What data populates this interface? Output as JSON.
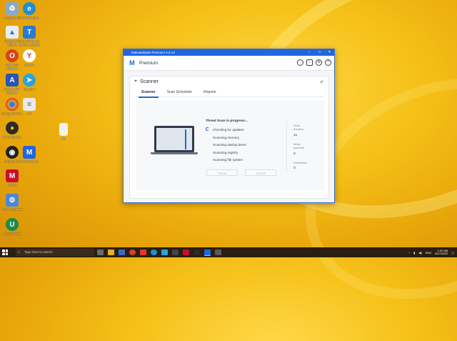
{
  "desktop": {
    "icons": [
      {
        "label": "Recycle Bin",
        "icon": "recycle-bin-icon",
        "color": "#8aa9c8"
      },
      {
        "label": "Microsoft Edge",
        "icon": "edge-icon",
        "color": "#1e8fd6"
      },
      {
        "label": "Google File Stream",
        "icon": "drive-icon",
        "color": "#e8eef7"
      },
      {
        "label": "Microsoft Teams (work or school)",
        "icon": "teams-icon",
        "color": "#2b79d8"
      },
      {
        "label": "Opera GX Browser",
        "icon": "opera-icon",
        "color": "#d4451a"
      },
      {
        "label": "Yandex",
        "icon": "yandex-icon",
        "color": "#e8352c"
      },
      {
        "label": "Advanced IP Scanner",
        "icon": "scanner-icon",
        "color": "#2755b8"
      },
      {
        "label": "Telegram",
        "icon": "telegram-icon",
        "color": "#2aa3de"
      },
      {
        "label": "Google Chrome",
        "icon": "chrome-icon",
        "color": "#e6b01e"
      },
      {
        "label": "text",
        "icon": "file-icon",
        "color": "#eaeaea"
      },
      {
        "label": "Malwarebytes",
        "icon": "malwarebytes-icon",
        "color": "#2b2b2b"
      },
      {
        "label": "file",
        "icon": "blank-file-icon",
        "color": "#f2f2f2"
      },
      {
        "label": "OBS Studio",
        "icon": "obs-icon",
        "color": "#222222"
      },
      {
        "label": "Malwarebytes",
        "icon": "malwarebytes-m-icon",
        "color": "#1f66e0"
      },
      {
        "label": "McAfee",
        "icon": "mcafee-icon",
        "color": "#c8102e"
      },
      {
        "label": "Driver Programs",
        "icon": "driver-icon",
        "color": "#4a88d8"
      },
      {
        "label": "Glary Utilities",
        "icon": "glary-icon",
        "color": "#1c8a4a"
      }
    ]
  },
  "window": {
    "title": "Malwarebytes Premium 4.5.13",
    "controls": {
      "minimize": "–",
      "maximize": "□",
      "close": "✕"
    },
    "header": {
      "product": "Premium"
    },
    "card": {
      "title": "Scanner",
      "collapse_glyph": "↙",
      "tabs": [
        {
          "label": "Scanner",
          "active": true
        },
        {
          "label": "Scan Scheduler",
          "active": false
        },
        {
          "label": "Reports",
          "active": false
        }
      ],
      "status_title": "Threat Scan in progress...",
      "steps": [
        "Checking for updates",
        "Scanning memory",
        "Scanning startup items",
        "Scanning registry",
        "Scanning file system"
      ],
      "metrics": [
        {
          "label": "Scan duration",
          "value": "1s"
        },
        {
          "label": "Items scanned",
          "value": "0"
        },
        {
          "label": "Detections",
          "value": "0"
        }
      ],
      "buttons": {
        "pause": "Pause",
        "cancel": "Cancel"
      }
    }
  },
  "taskbar": {
    "search_placeholder": "Type here to search",
    "language": "ENG",
    "time": "1:02 AM",
    "date": "8/17/2022"
  },
  "colors": {
    "accent": "#1f66e0",
    "titlebar": "#1f66e0"
  }
}
